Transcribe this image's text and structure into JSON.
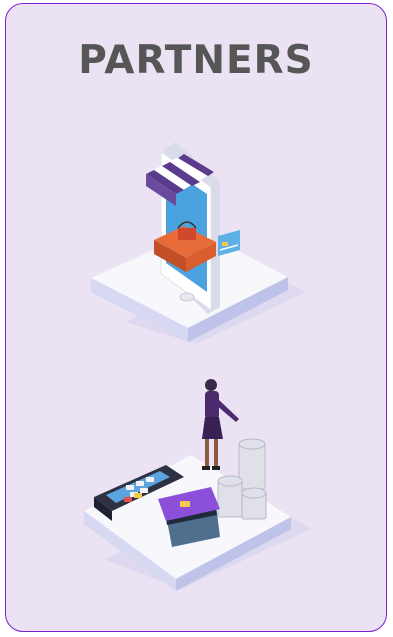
{
  "section": {
    "title": "PARTNERS"
  },
  "illustrations": [
    {
      "icon": "mobile-storefront-icon"
    },
    {
      "icon": "payment-terminal-icon"
    }
  ],
  "colors": {
    "background": "#ebe3f3",
    "border": "#7a1fd0",
    "title": "#565656",
    "accent_purple": "#6b3aa6"
  }
}
